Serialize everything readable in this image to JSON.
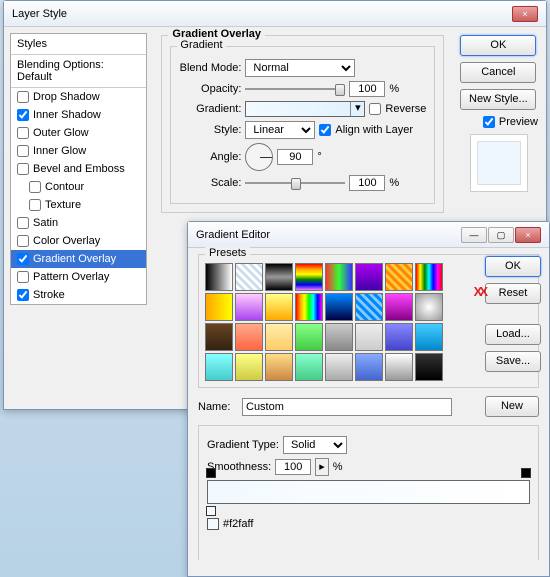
{
  "layerStyle": {
    "title": "Layer Style",
    "stylesHeader": "Styles",
    "blendingOptions": "Blending Options: Default",
    "items": [
      {
        "label": "Drop Shadow",
        "checked": false,
        "selected": false
      },
      {
        "label": "Inner Shadow",
        "checked": true,
        "selected": false
      },
      {
        "label": "Outer Glow",
        "checked": false,
        "selected": false
      },
      {
        "label": "Inner Glow",
        "checked": false,
        "selected": false
      },
      {
        "label": "Bevel and Emboss",
        "checked": false,
        "selected": false
      },
      {
        "label": "Contour",
        "checked": false,
        "selected": false,
        "indent": true
      },
      {
        "label": "Texture",
        "checked": false,
        "selected": false,
        "indent": true
      },
      {
        "label": "Satin",
        "checked": false,
        "selected": false
      },
      {
        "label": "Color Overlay",
        "checked": false,
        "selected": false
      },
      {
        "label": "Gradient Overlay",
        "checked": true,
        "selected": true
      },
      {
        "label": "Pattern Overlay",
        "checked": false,
        "selected": false
      },
      {
        "label": "Stroke",
        "checked": true,
        "selected": false
      }
    ],
    "section": {
      "title": "Gradient Overlay",
      "inner": "Gradient",
      "blendMode": {
        "label": "Blend Mode:",
        "value": "Normal"
      },
      "opacity": {
        "label": "Opacity:",
        "value": "100",
        "unit": "%"
      },
      "gradient": {
        "label": "Gradient:",
        "reverse": "Reverse"
      },
      "style": {
        "label": "Style:",
        "value": "Linear",
        "align": "Align with Layer"
      },
      "angle": {
        "label": "Angle:",
        "value": "90",
        "unit": "°"
      },
      "scale": {
        "label": "Scale:",
        "value": "100",
        "unit": "%"
      }
    },
    "buttons": {
      "ok": "OK",
      "cancel": "Cancel",
      "newStyle": "New Style...",
      "preview": "Preview"
    }
  },
  "gradEditor": {
    "title": "Gradient Editor",
    "presets": "Presets",
    "name": {
      "label": "Name:",
      "value": "Custom"
    },
    "type": {
      "label": "Gradient Type:",
      "value": "Solid"
    },
    "smooth": {
      "label": "Smoothness:",
      "value": "100",
      "unit": "%"
    },
    "colorStop": "#f2faff",
    "buttons": {
      "ok": "OK",
      "reset": "Reset",
      "load": "Load...",
      "save": "Save...",
      "new": "New"
    }
  }
}
